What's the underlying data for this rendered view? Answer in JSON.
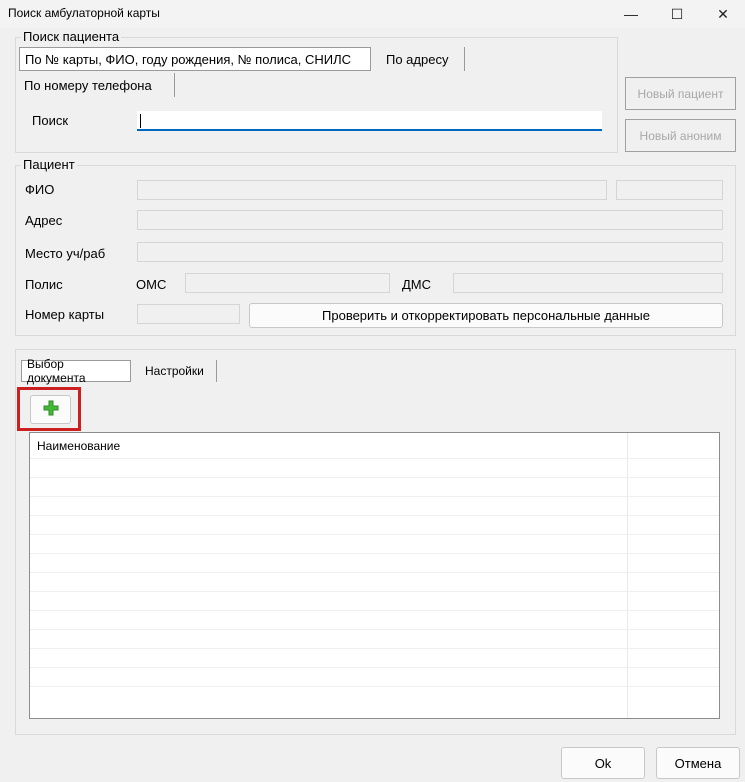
{
  "window": {
    "title": "Поиск амбулаторной карты",
    "minimize": "—",
    "maximize": "☐",
    "close": "✕"
  },
  "search": {
    "legend": "Поиск пациента",
    "tabs": [
      "По № карты, ФИО, году рождения, № полиса, СНИЛС",
      "По адресу",
      "По номеру телефона"
    ],
    "label": "Поиск",
    "value": ""
  },
  "buttons": {
    "new_patient": "Новый пациент",
    "new_anon": "Новый аноним",
    "verify": "Проверить и откорректировать персональные данные",
    "ok": "Ok",
    "cancel": "Отмена"
  },
  "patient": {
    "legend": "Пациент",
    "fio": "ФИО",
    "address": "Адрес",
    "work": "Место уч/раб",
    "policy": "Полис",
    "oms": "ОМС",
    "dms": "ДМС",
    "card": "Номер карты"
  },
  "docs": {
    "tabs": [
      "Выбор документа",
      "Настройки"
    ],
    "add_icon": "plus-icon",
    "columns": [
      "Наименование",
      ""
    ],
    "accent": "#cc1f1f"
  }
}
